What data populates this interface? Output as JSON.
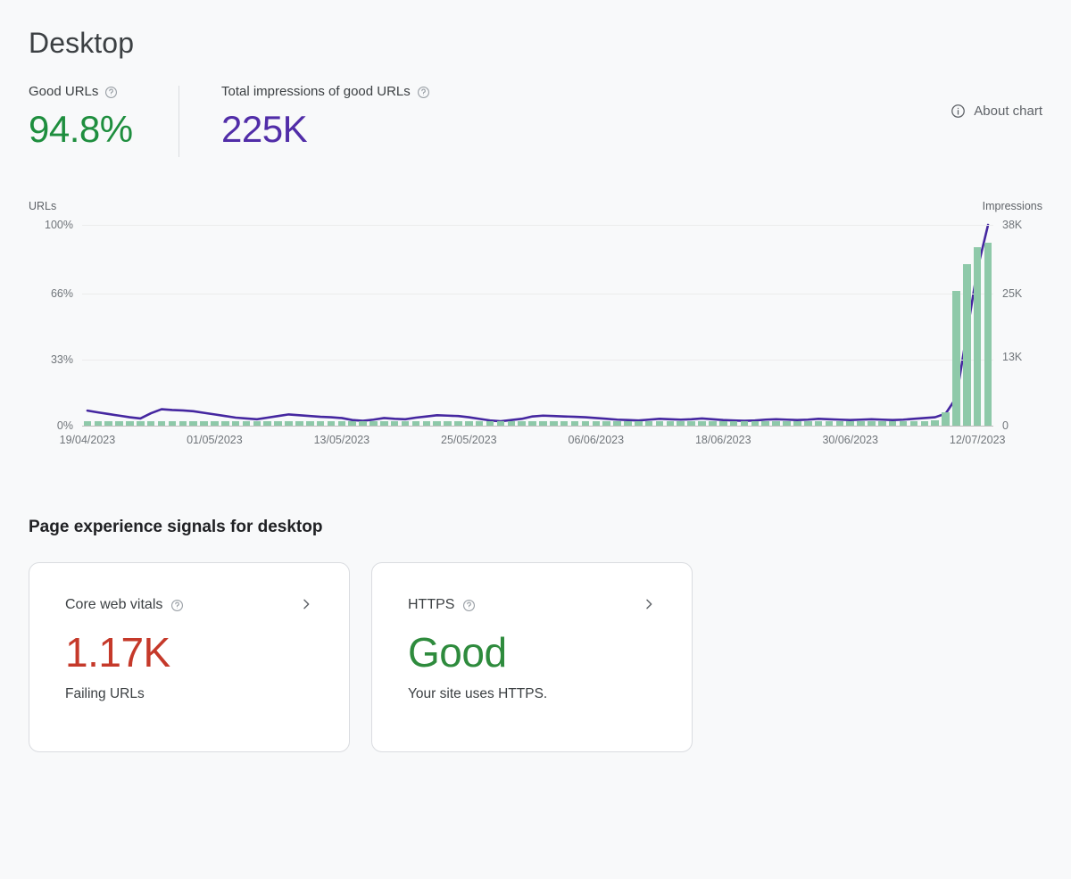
{
  "header": {
    "title": "Desktop",
    "about_chart_label": "About chart",
    "about_icon": "info-icon",
    "kpis": [
      {
        "label": "Good URLs",
        "value": "94.8%",
        "color": "#1e8e3e",
        "help_icon": "help-icon"
      },
      {
        "label": "Total impressions of good URLs",
        "value": "225K",
        "color": "#512da8",
        "help_icon": "help-icon"
      }
    ]
  },
  "chart_data": {
    "type": "line",
    "title": "",
    "left_axis_title": "URLs",
    "right_axis_title": "Impressions",
    "grid": true,
    "legend": null,
    "left_ticks": [
      "100%",
      "66%",
      "33%",
      "0%"
    ],
    "left_tick_values": [
      100,
      66,
      33,
      0
    ],
    "right_ticks": [
      "38K",
      "25K",
      "13K",
      "0"
    ],
    "right_tick_values": [
      38000,
      25000,
      13000,
      0
    ],
    "ylim": [
      0,
      100
    ],
    "y2lim": [
      0,
      38000
    ],
    "xlabel": "",
    "ylabel": "URLs",
    "y2label": "Impressions",
    "tick_labels": [
      "19/04/2023",
      "01/05/2023",
      "13/05/2023",
      "25/05/2023",
      "06/06/2023",
      "18/06/2023",
      "30/06/2023",
      "12/07/2023"
    ],
    "tick_indices": [
      0,
      12,
      24,
      36,
      48,
      60,
      72,
      84
    ],
    "series": [
      {
        "name": "Good URLs",
        "axis": "left",
        "type": "line",
        "color": "#4527a0",
        "units": "%",
        "values": [
          7.5,
          6.6,
          5.8,
          5.0,
          4.2,
          3.6,
          6.2,
          8.2,
          7.8,
          7.6,
          7.2,
          6.4,
          5.6,
          4.8,
          4.0,
          3.6,
          3.2,
          4.0,
          4.8,
          5.6,
          5.2,
          4.8,
          4.4,
          4.2,
          3.8,
          2.8,
          2.4,
          3.0,
          3.8,
          3.4,
          3.2,
          4.0,
          4.6,
          5.2,
          5.0,
          4.8,
          4.2,
          3.4,
          2.6,
          2.2,
          2.8,
          3.4,
          4.6,
          5.0,
          4.8,
          4.6,
          4.4,
          4.2,
          3.8,
          3.4,
          3.0,
          2.8,
          2.6,
          3.0,
          3.4,
          3.2,
          3.0,
          3.2,
          3.6,
          3.2,
          2.8,
          2.6,
          2.4,
          2.6,
          3.0,
          3.2,
          3.0,
          2.8,
          3.0,
          3.4,
          3.2,
          3.0,
          2.8,
          3.0,
          3.2,
          3.0,
          2.8,
          3.0,
          3.4,
          3.8,
          4.2,
          6.0,
          14.0,
          46.0,
          78.0,
          100.0
        ]
      },
      {
        "name": "Impressions of good URLs",
        "axis": "right",
        "type": "bar",
        "color": "#8ec9a9",
        "units": "impressions",
        "values": [
          900,
          900,
          900,
          900,
          900,
          900,
          900,
          900,
          900,
          900,
          900,
          900,
          900,
          900,
          900,
          900,
          900,
          900,
          900,
          900,
          900,
          900,
          900,
          900,
          900,
          900,
          900,
          900,
          900,
          900,
          900,
          900,
          900,
          900,
          900,
          900,
          900,
          900,
          900,
          900,
          900,
          900,
          900,
          900,
          900,
          900,
          900,
          900,
          800,
          800,
          800,
          800,
          800,
          800,
          800,
          800,
          800,
          800,
          800,
          800,
          800,
          800,
          800,
          800,
          800,
          800,
          800,
          800,
          800,
          800,
          800,
          800,
          800,
          800,
          800,
          800,
          800,
          800,
          800,
          800,
          1000,
          2600,
          25500,
          30500,
          33800,
          34600
        ]
      }
    ]
  },
  "signals": {
    "title": "Page experience signals for desktop",
    "cards": [
      {
        "title": "Core web vitals",
        "help_icon": "help-icon",
        "chevron_icon": "chevron-right-icon",
        "value": "1.17K",
        "value_color": "#c5392a",
        "subtitle": "Failing URLs"
      },
      {
        "title": "HTTPS",
        "help_icon": "help-icon",
        "chevron_icon": "chevron-right-icon",
        "value": "Good",
        "value_color": "#2e8b3d",
        "subtitle": "Your site uses HTTPS."
      }
    ]
  }
}
